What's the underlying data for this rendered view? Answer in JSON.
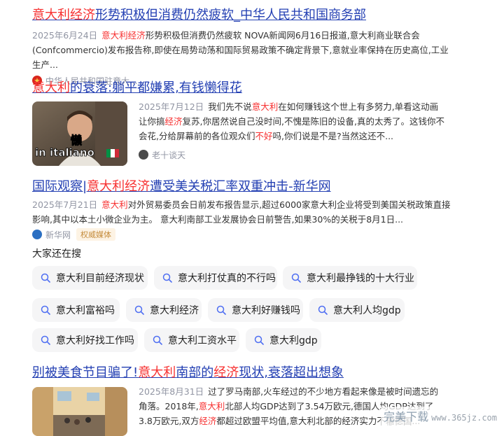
{
  "results": [
    {
      "title_hl": "意大利经济",
      "title_rest": "形势积极但消费仍然疲软_中华人民共和国商务部",
      "date": "2025年6月24日",
      "abstract_hl": "意大利经济",
      "abstract_rest": "形势积极但消费仍然疲软 NOVA新闻网6月16日报道,意大利商业联合会(Confcommercio)发布报告称,即使在局势动荡和国际贸易政策不确定背景下,意就业率保持在历史高位,工业生产...",
      "source": "中华人民共和国驻意大..."
    },
    {
      "title_hl": "意大利",
      "title_rest": "的衰落:躺平都嫌累,有钱懒得花",
      "date": "2025年7月12日",
      "abstract_p1": "我们先不说",
      "abstract_hl1": "意大利",
      "abstract_p2": "在如何赚钱这个世上有多努力,单看这动画让你搞",
      "abstract_hl2": "经济",
      "abstract_p3": "复苏,你居然说自己没时间,不愧是陈旧的设备,真的太秀了。这钱你不会花,分给屏幕前的各位观众们",
      "abstract_hl3": "不好",
      "abstract_p4": "吗,你们说是不是?当然这还不...",
      "source": "老十谈天",
      "thumb_caption_cn": "懒",
      "thumb_caption_en": "in italiano"
    },
    {
      "title_p1": "国际观察|",
      "title_hl": "意大利经济",
      "title_rest": "遭受美关税汇率双重冲击-新华网",
      "date": "2025年7月21日",
      "abstract_hl": "意大利",
      "abstract_rest": "对外贸易委员会日前发布报告显示,超过6000家意大利企业将受到美国关税政策直接影响,其中以本土小微企业为主。    意大利南部工业发展协会日前警告,如果30%的关税于8月1日...",
      "source": "新华网",
      "tag": "权威媒体"
    },
    {
      "title_p1": "别被美食节目骗了!",
      "title_hl1": "意大利",
      "title_p2": "南部的",
      "title_hl2": "经济",
      "title_rest": "现状,衰落超出想象",
      "date": "2025年8月31日",
      "abstract_p1": "过了罗马南部,火车经过的不少地方看起来像是被时间遗忘的角落。2018年,",
      "abstract_hl1": "意大利",
      "abstract_p2": "北部人均GDP达到了3.54万欧元,德国人均GDP达到了3.8万欧元,双方",
      "abstract_hl2": "经济",
      "abstract_p3": "都超过欧盟平均值,意大利北部的经济实力不输德国..."
    }
  ],
  "also_search": {
    "title": "大家还在搜",
    "items": [
      "意大利目前经济现状",
      "意大利打仗真的不行吗",
      "意大利最挣钱的十大行业",
      "意大利富裕吗",
      "意大利经济",
      "意大利好赚钱吗",
      "意大利人均gdp",
      "意大利好找工作吗",
      "意大利工资水平",
      "意大利gdp"
    ]
  },
  "watermark": {
    "brand": "完美下载",
    "url": "www.365jz.com"
  },
  "colors": {
    "link": "#2440b3",
    "highlight": "#f73131",
    "meta": "#9195a3",
    "chip_bg": "#f5f5f6"
  }
}
